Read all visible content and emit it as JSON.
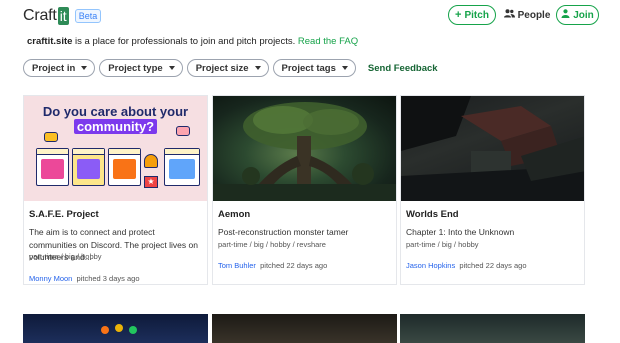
{
  "header": {
    "logo_text": "Craft",
    "logo_it": "it",
    "beta": "Beta",
    "pitch_label": "Pitch",
    "people_label": "People",
    "join_label": "Join"
  },
  "tagline": {
    "site": "craftit.site",
    "text": " is a place for professionals to join and pitch projects. ",
    "faq": "Read the FAQ"
  },
  "filters": {
    "items": [
      {
        "label": "Project in"
      },
      {
        "label": "Project type"
      },
      {
        "label": "Project size"
      },
      {
        "label": "Project tags"
      }
    ],
    "feedback": "Send Feedback"
  },
  "cards": [
    {
      "title": "S.A.F.E. Project",
      "desc": "The aim is to connect and protect communities on Discord. The project lives on volunteers and...",
      "tags": "part-time / big / hobby",
      "user": "Monny Moon",
      "when": "pitched 3 days ago",
      "image_heading_1": "Do you care about your",
      "image_heading_2": "community?"
    },
    {
      "title": "Aemon",
      "desc": "Post-reconstruction monster tamer",
      "tags": "part-time / big / hobby / revshare",
      "user": "Tom Buhler",
      "when": "pitched 22 days ago"
    },
    {
      "title": "Worlds End",
      "desc": "Chapter 1: Into the Unknown",
      "tags": "part-time / big / hobby",
      "user": "Jason Hopkins",
      "when": "pitched 22 days ago"
    }
  ],
  "colors": {
    "accent": "#16a34a",
    "link": "#2563eb",
    "feedback": "#166534"
  }
}
